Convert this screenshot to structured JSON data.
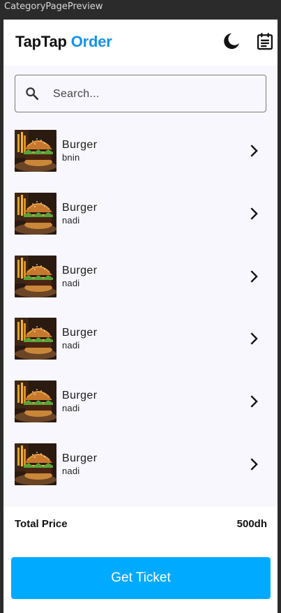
{
  "window": {
    "title": "CategoryPagePreview"
  },
  "header": {
    "brand_part1": "TapTap",
    "brand_part2": "Order",
    "icons": [
      "moon-icon",
      "calendar-icon"
    ]
  },
  "search": {
    "placeholder": "Search...",
    "value": "",
    "icon": "search-icon"
  },
  "items": [
    {
      "name": "Burger",
      "subtitle": "bnin"
    },
    {
      "name": "Burger",
      "subtitle": "nadi"
    },
    {
      "name": "Burger",
      "subtitle": "nadi"
    },
    {
      "name": "Burger",
      "subtitle": "nadi"
    },
    {
      "name": "Burger",
      "subtitle": "nadi"
    },
    {
      "name": "Burger",
      "subtitle": "nadi"
    }
  ],
  "footer": {
    "total_label": "Total Price",
    "total_value": "500dh",
    "button_label": "Get Ticket"
  },
  "colors": {
    "accent": "#00aaff",
    "brand_blue": "#1592e6",
    "content_bg": "#f8f7fd"
  }
}
